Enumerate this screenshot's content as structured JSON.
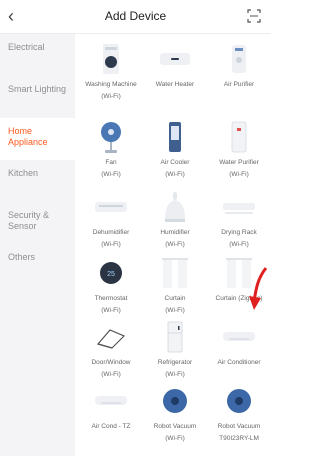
{
  "header": {
    "title": "Add Device",
    "back_icon": "chevron-left-icon",
    "scan_icon": "scan-icon"
  },
  "sidebar": {
    "active_color": "#ff5a1f",
    "items": [
      {
        "label": "Electrical"
      },
      {
        "label": "Smart Lighting"
      },
      {
        "label": "Home Appliance"
      },
      {
        "label": "Kitchen"
      },
      {
        "label": "Security & Sensor"
      },
      {
        "label": "Others"
      }
    ]
  },
  "devices": [
    {
      "name": "Washing Machine",
      "sub": "(Wi-Fi)",
      "icon": "washing-machine-icon"
    },
    {
      "name": "Water Heater",
      "sub": "",
      "icon": "water-heater-icon"
    },
    {
      "name": "Air Purifier",
      "sub": "",
      "icon": "air-purifier-icon"
    },
    {
      "name": "Fan",
      "sub": "(Wi-Fi)",
      "icon": "fan-icon"
    },
    {
      "name": "Air Cooler",
      "sub": "(Wi-Fi)",
      "icon": "air-cooler-icon"
    },
    {
      "name": "Water Purifier",
      "sub": "(Wi-Fi)",
      "icon": "water-purifier-icon"
    },
    {
      "name": "Dehumidifier",
      "sub": "(Wi-Fi)",
      "icon": "dehumidifier-icon"
    },
    {
      "name": "Humidifier",
      "sub": "(Wi-Fi)",
      "icon": "humidifier-icon"
    },
    {
      "name": "Drying Rack",
      "sub": "(Wi-Fi)",
      "icon": "drying-rack-icon"
    },
    {
      "name": "Thermostat",
      "sub": "(Wi-Fi)",
      "icon": "thermostat-icon"
    },
    {
      "name": "Curtain",
      "sub": "(Wi-Fi)",
      "icon": "curtain-icon"
    },
    {
      "name": "Curtain (Zigbee)",
      "sub": "",
      "icon": "curtain-zigbee-icon"
    },
    {
      "name": "Door/Window",
      "sub": "(Wi-Fi)",
      "icon": "door-window-icon"
    },
    {
      "name": "Refrigerator",
      "sub": "(Wi-Fi)",
      "icon": "refrigerator-icon"
    },
    {
      "name": "Air Conditioner",
      "sub": "",
      "icon": "air-conditioner-icon"
    },
    {
      "name": "Air Cond - TZ",
      "sub": "",
      "icon": "air-cond-tz-icon"
    },
    {
      "name": "Robot Vacuum",
      "sub": "(Wi-Fi)",
      "icon": "robot-vacuum-icon"
    },
    {
      "name": "Robot Vacuum",
      "sub": "T90I23RY-LM",
      "icon": "robot-vacuum-icon"
    }
  ]
}
